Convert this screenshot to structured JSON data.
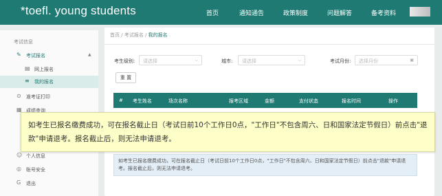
{
  "header": {
    "logo": "*toefl. young students",
    "nav": [
      "首页",
      "通知通告",
      "政策制度",
      "问题解答",
      "备考资料"
    ]
  },
  "sidebar": {
    "heading": "考试信息",
    "items": [
      {
        "label": "考试报名",
        "icon": "edit-icon"
      },
      {
        "label": "网上报名",
        "icon": "document-icon"
      },
      {
        "label": "我的报名",
        "icon": "list-icon"
      },
      {
        "label": "准考证打印",
        "icon": "print-icon"
      },
      {
        "label": "成绩查询",
        "icon": "search-doc-icon"
      },
      {
        "label": "个人信息",
        "icon": "user-icon"
      },
      {
        "label": "账号安全",
        "icon": "shield-icon"
      },
      {
        "label": "退出",
        "icon": "logout-icon"
      }
    ]
  },
  "breadcrumb": {
    "home": "首页",
    "sep1": "/",
    "mid": "考试报名",
    "sep2": "/",
    "current": "我的报名"
  },
  "filters": {
    "level_label": "考生级别:",
    "level_placeholder": "请选择",
    "city_label": "城市:",
    "city_placeholder": "请选择",
    "month_label": "考试月份:",
    "month_placeholder": "选择月份",
    "reset_label": "重 置"
  },
  "table": {
    "headers": [
      "#",
      "考生姓名",
      "场次名称",
      "报考区域",
      "金额",
      "支付状态",
      "报名时间",
      "操作"
    ]
  },
  "notice": {
    "small": "如考生已报名缴费成功，可在报名截止日（考试日前10个工作日0点，\"工作日\"不包含周六、日和国家法定节假日）前点击\"退款\"申请退考。报名截止后，则无法申请退考。",
    "overlay": "如考生已报名缴费成功，可在报名截止日（考试日前10个工作日0点，\"工作日\"不包含周六、日和国家法定节假日）前点击\"退款\"申请退考。报名截止后，则无法申请退考。"
  },
  "colors": {
    "brand": "#1f7a73",
    "overlay_bg": "#fefec9",
    "notice_bg": "#e3eef6"
  }
}
